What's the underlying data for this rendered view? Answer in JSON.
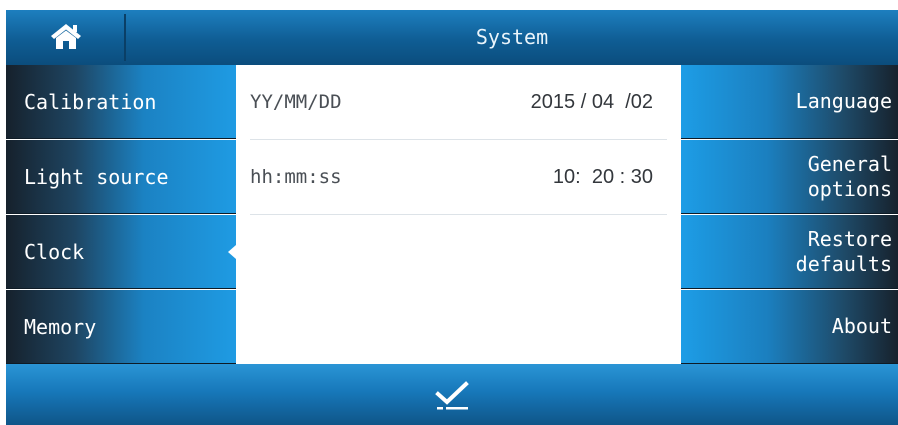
{
  "header": {
    "title": "System",
    "home_icon": "home-icon"
  },
  "left_nav": {
    "items": [
      {
        "label": "Calibration",
        "active": false
      },
      {
        "label": "Light source",
        "active": false
      },
      {
        "label": "Clock",
        "active": true
      },
      {
        "label": "Memory",
        "active": false
      }
    ]
  },
  "clock": {
    "date_label": "YY/MM/DD",
    "date_value": "2015 / 04  /02",
    "time_label": "hh:mm:ss",
    "time_value": "10:  20 : 30"
  },
  "right_nav": {
    "items": [
      {
        "label": "Language"
      },
      {
        "label": "General\noptions"
      },
      {
        "label": "Restore\ndefaults"
      },
      {
        "label": "About"
      }
    ]
  },
  "footer": {
    "confirm_icon": "checkmark-confirm-icon"
  },
  "colors": {
    "accent": "#1f9be3",
    "dark": "#17222d",
    "topbar": "#0f5d94"
  }
}
